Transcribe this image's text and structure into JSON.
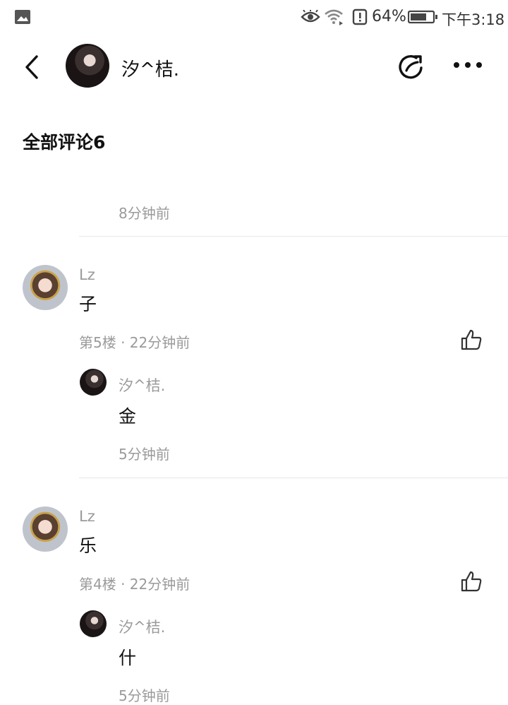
{
  "status_bar": {
    "battery": "64%",
    "time": "下午3:18",
    "icons": [
      "image-icon",
      "eye-icon",
      "wifi-icon",
      "alert-icon",
      "battery-icon"
    ]
  },
  "header": {
    "username": "汐^桔.",
    "icons": [
      "back-icon",
      "share-icon",
      "more-icon"
    ]
  },
  "comments": {
    "title": "全部评论6",
    "partial_time": "8分钟前",
    "items": [
      {
        "user": "Lz",
        "text": "子",
        "meta": "第5楼 · 22分钟前",
        "reply": {
          "user": "汐^桔.",
          "text": "金",
          "time": "5分钟前"
        }
      },
      {
        "user": "Lz",
        "text": "乐",
        "meta": "第4楼 · 22分钟前",
        "reply": {
          "user": "汐^桔.",
          "text": "什",
          "time": "5分钟前"
        }
      }
    ]
  }
}
